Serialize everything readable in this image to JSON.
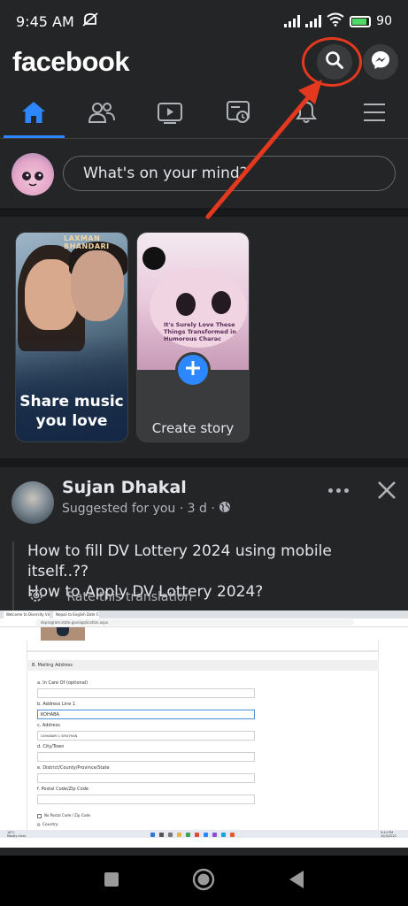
{
  "status_bar": {
    "time": "9:45 AM",
    "battery": "90",
    "icons": [
      "mute-icon",
      "signal-icon",
      "signal-icon",
      "wifi-icon",
      "battery-icon"
    ]
  },
  "header": {
    "logo": "facebook",
    "search_icon": "search-icon",
    "messenger_icon": "messenger-icon"
  },
  "nav_tabs": [
    {
      "name": "home",
      "icon": "home-icon",
      "active": true
    },
    {
      "name": "friends",
      "icon": "friends-icon",
      "active": false
    },
    {
      "name": "watch",
      "icon": "video-icon",
      "active": false
    },
    {
      "name": "memories",
      "icon": "memories-icon",
      "active": false
    },
    {
      "name": "notifications",
      "icon": "bell-icon",
      "active": false
    },
    {
      "name": "menu",
      "icon": "menu-icon",
      "active": false
    }
  ],
  "composer": {
    "placeholder": "What's on your mind?"
  },
  "stories": [
    {
      "label": "Share music you love",
      "poster_text": "LAXMAN BHANDARI"
    },
    {
      "label": "Create story",
      "image_text": "It's Surely Love These Things Transformed in Humorous Charac"
    }
  ],
  "post": {
    "author": "Sujan Dhakal",
    "meta": "Suggested for you · 3 d ·",
    "text_line1": "How to fill DV Lottery 2024 using mobile itself..??",
    "text_line2": "How to Apply DV Lottery 2024?",
    "translate_label": "Rate this translation"
  },
  "embedded_screenshot": {
    "tab1": "Welcome to Diversity Visa Program",
    "tab2": "Nepali to English Date Converte",
    "url": "dvprogram.state.gov/application.aspx",
    "section_title": "B. Mailing Address",
    "fields": [
      {
        "label": "a. In Care Of (optional)",
        "value": ""
      },
      {
        "label": "b. Address Line 1",
        "value": "KOHABA"
      },
      {
        "label": "c. Address",
        "value": "GOHABARI 1 SIRUTHAN"
      },
      {
        "label": "d. City/Town",
        "value": ""
      },
      {
        "label": "e. District/County/Province/State",
        "value": ""
      },
      {
        "label": "f. Postal Code/Zip Code",
        "value": ""
      }
    ],
    "no_postal": "No Postal Code / Zip Code",
    "country_label": "g. Country",
    "taskbar_left": "16°C",
    "taskbar_left2": "Mostly clear",
    "taskbar_right": "9:44 PM",
    "taskbar_right2": "10/4/2022"
  },
  "colors": {
    "background": "#242526",
    "accent": "#2d88ff",
    "annotation": "#e4381f"
  },
  "system_nav": {
    "buttons": [
      "recents-icon",
      "home-circle-icon",
      "back-icon"
    ]
  }
}
